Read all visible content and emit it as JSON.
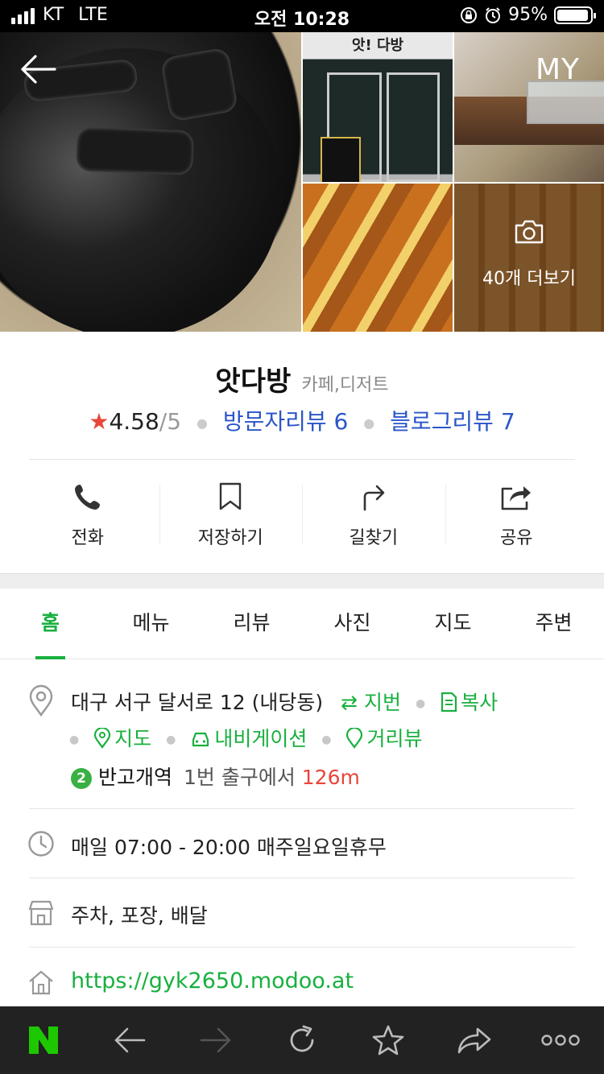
{
  "status_bar": {
    "carrier": "KT",
    "network": "LTE",
    "time": "오전 10:28",
    "battery": "95%",
    "battery_level": 0.95
  },
  "photos": {
    "more_label": "40개 더보기",
    "my_label": "MY",
    "sign_text": "앗! 다방"
  },
  "place": {
    "name": "앗다방",
    "category": "카페,디저트",
    "rating": "4.58",
    "rating_max": "/5",
    "visitor_reviews": "방문자리뷰 6",
    "blog_reviews": "블로그리뷰 7"
  },
  "actions": [
    {
      "label": "전화",
      "icon": "phone-icon"
    },
    {
      "label": "저장하기",
      "icon": "bookmark-icon"
    },
    {
      "label": "길찾기",
      "icon": "directions-icon"
    },
    {
      "label": "공유",
      "icon": "share-icon"
    }
  ],
  "tabs": [
    {
      "label": "홈"
    },
    {
      "label": "메뉴"
    },
    {
      "label": "리뷰"
    },
    {
      "label": "사진"
    },
    {
      "label": "지도"
    },
    {
      "label": "주변"
    }
  ],
  "info": {
    "address": "대구 서구 달서로 12 (내당동)",
    "jibun": "지번",
    "copy": "복사",
    "map": "지도",
    "navigation": "내비게이션",
    "street_view": "거리뷰",
    "subway_line": "2",
    "subway_station": "반고개역",
    "subway_exit": "1번 출구에서",
    "subway_distance": "126m",
    "hours": "매일 07:00 - 20:00 매주일요일휴무",
    "services": "주차, 포장, 배달",
    "website": "https://gyk2650.modoo.at"
  },
  "colors": {
    "accent_green": "#19b03f",
    "link_blue": "#2b56c8",
    "star_red": "#e8463a",
    "toolbar_bg": "#222222"
  }
}
